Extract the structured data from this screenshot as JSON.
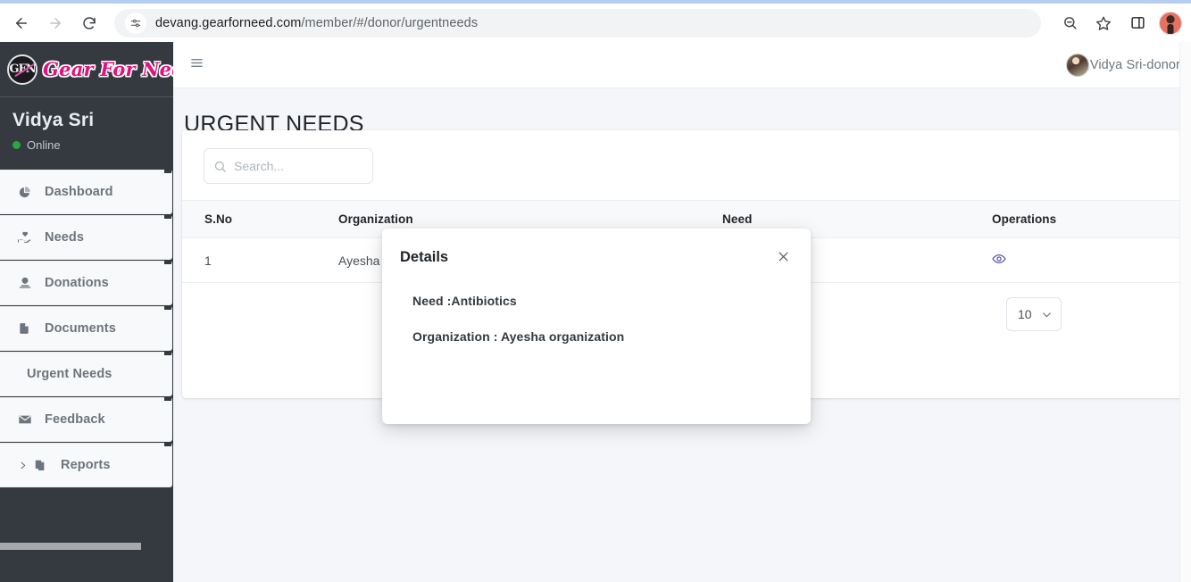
{
  "browser": {
    "url_prefix": "devang.gearforneed.com",
    "url_path": "/member/#/donor/urgentneeds",
    "back_icon": "back-arrow-icon",
    "forward_icon": "forward-arrow-icon",
    "reload_icon": "reload-icon",
    "site_info_icon": "site-settings-icon",
    "zoom_out_icon": "zoom-out-icon",
    "bookmark_icon": "bookmark-star-icon",
    "side_panel_icon": "side-panel-icon",
    "profile_icon": "profile-avatar"
  },
  "sidebar": {
    "brand": {
      "mark": "GFN",
      "text": "Gear For Need"
    },
    "user": {
      "name": "Vidya Sri",
      "status": "Online",
      "status_color": "#28a745"
    },
    "items": [
      {
        "label": "Dashboard",
        "icon": "pie-chart-icon",
        "has_icon": true,
        "has_caret": false,
        "active": false
      },
      {
        "label": "Needs",
        "icon": "hand-heart-icon",
        "has_icon": true,
        "has_caret": false,
        "active": false
      },
      {
        "label": "Donations",
        "icon": "donation-icon",
        "has_icon": true,
        "has_caret": false,
        "active": false
      },
      {
        "label": "Documents",
        "icon": "file-icon",
        "has_icon": true,
        "has_caret": false,
        "active": false
      },
      {
        "label": "Urgent Needs",
        "icon": "",
        "has_icon": false,
        "has_caret": false,
        "active": true
      },
      {
        "label": "Feedback",
        "icon": "envelope-icon",
        "has_icon": true,
        "has_caret": false,
        "active": false
      },
      {
        "label": "Reports",
        "icon": "copy-files-icon",
        "has_icon": true,
        "has_caret": true,
        "active": false
      }
    ]
  },
  "topbar": {
    "menu_toggle_icon": "hamburger-icon",
    "username": "Vidya Sri-donor"
  },
  "page": {
    "title": "URGENT NEEDS"
  },
  "search": {
    "placeholder": "Search...",
    "value": "",
    "icon": "search-icon"
  },
  "table": {
    "columns": [
      "S.No",
      "Organization",
      "Need",
      "Operations"
    ],
    "rows": [
      {
        "sno": "1",
        "organization": "Ayesha organization",
        "need": "Antibiotics",
        "operation_icon": "eye-icon"
      }
    ],
    "operation_icon_color": "#4a45a8"
  },
  "pagination": {
    "page_size": "10",
    "caret_icon": "chevron-down-icon"
  },
  "modal": {
    "title": "Details",
    "close_icon": "close-icon",
    "lines": [
      "Need :Antibiotics",
      "Organization : Ayesha organization"
    ]
  }
}
